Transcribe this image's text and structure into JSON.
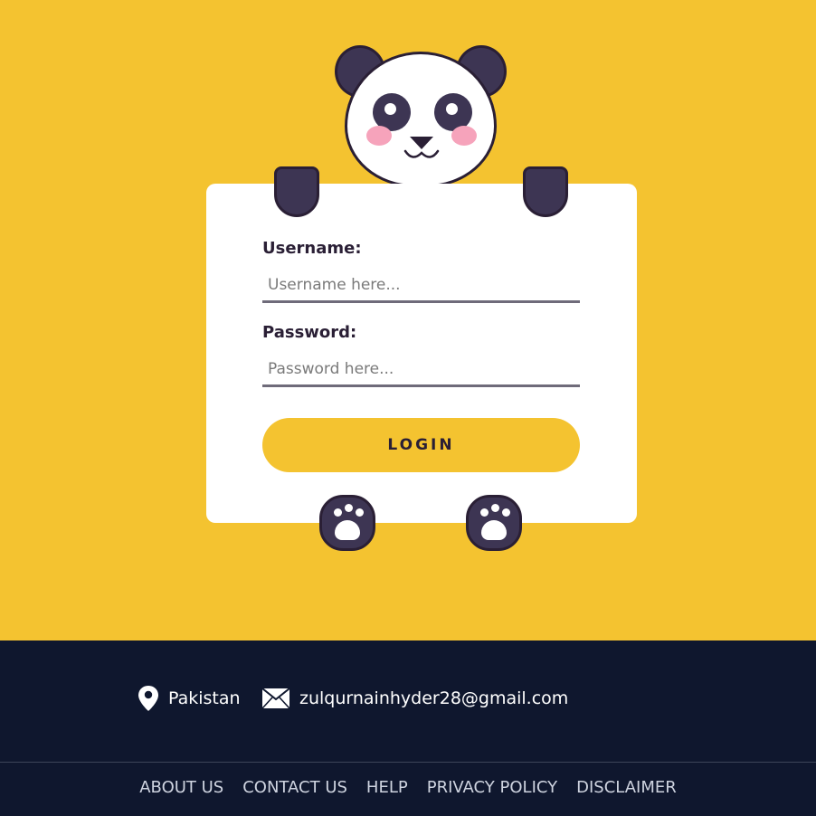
{
  "form": {
    "username_label": "Username:",
    "username_placeholder": "Username here...",
    "password_label": "Password:",
    "password_placeholder": "Password here...",
    "login_label": "LOGIN"
  },
  "footer": {
    "location": "Pakistan",
    "email": "zulqurnainhyder28@gmail.com",
    "links": [
      "ABOUT US",
      "CONTACT US",
      "HELP",
      "PRIVACY POLICY",
      "DISCLAIMER"
    ]
  },
  "colors": {
    "background": "#f4c330",
    "footer": "#0f172e",
    "panda_dark": "#3d3553",
    "button": "#f4c330"
  },
  "icons": [
    "panda-mascot",
    "location-pin-icon",
    "envelope-icon"
  ]
}
